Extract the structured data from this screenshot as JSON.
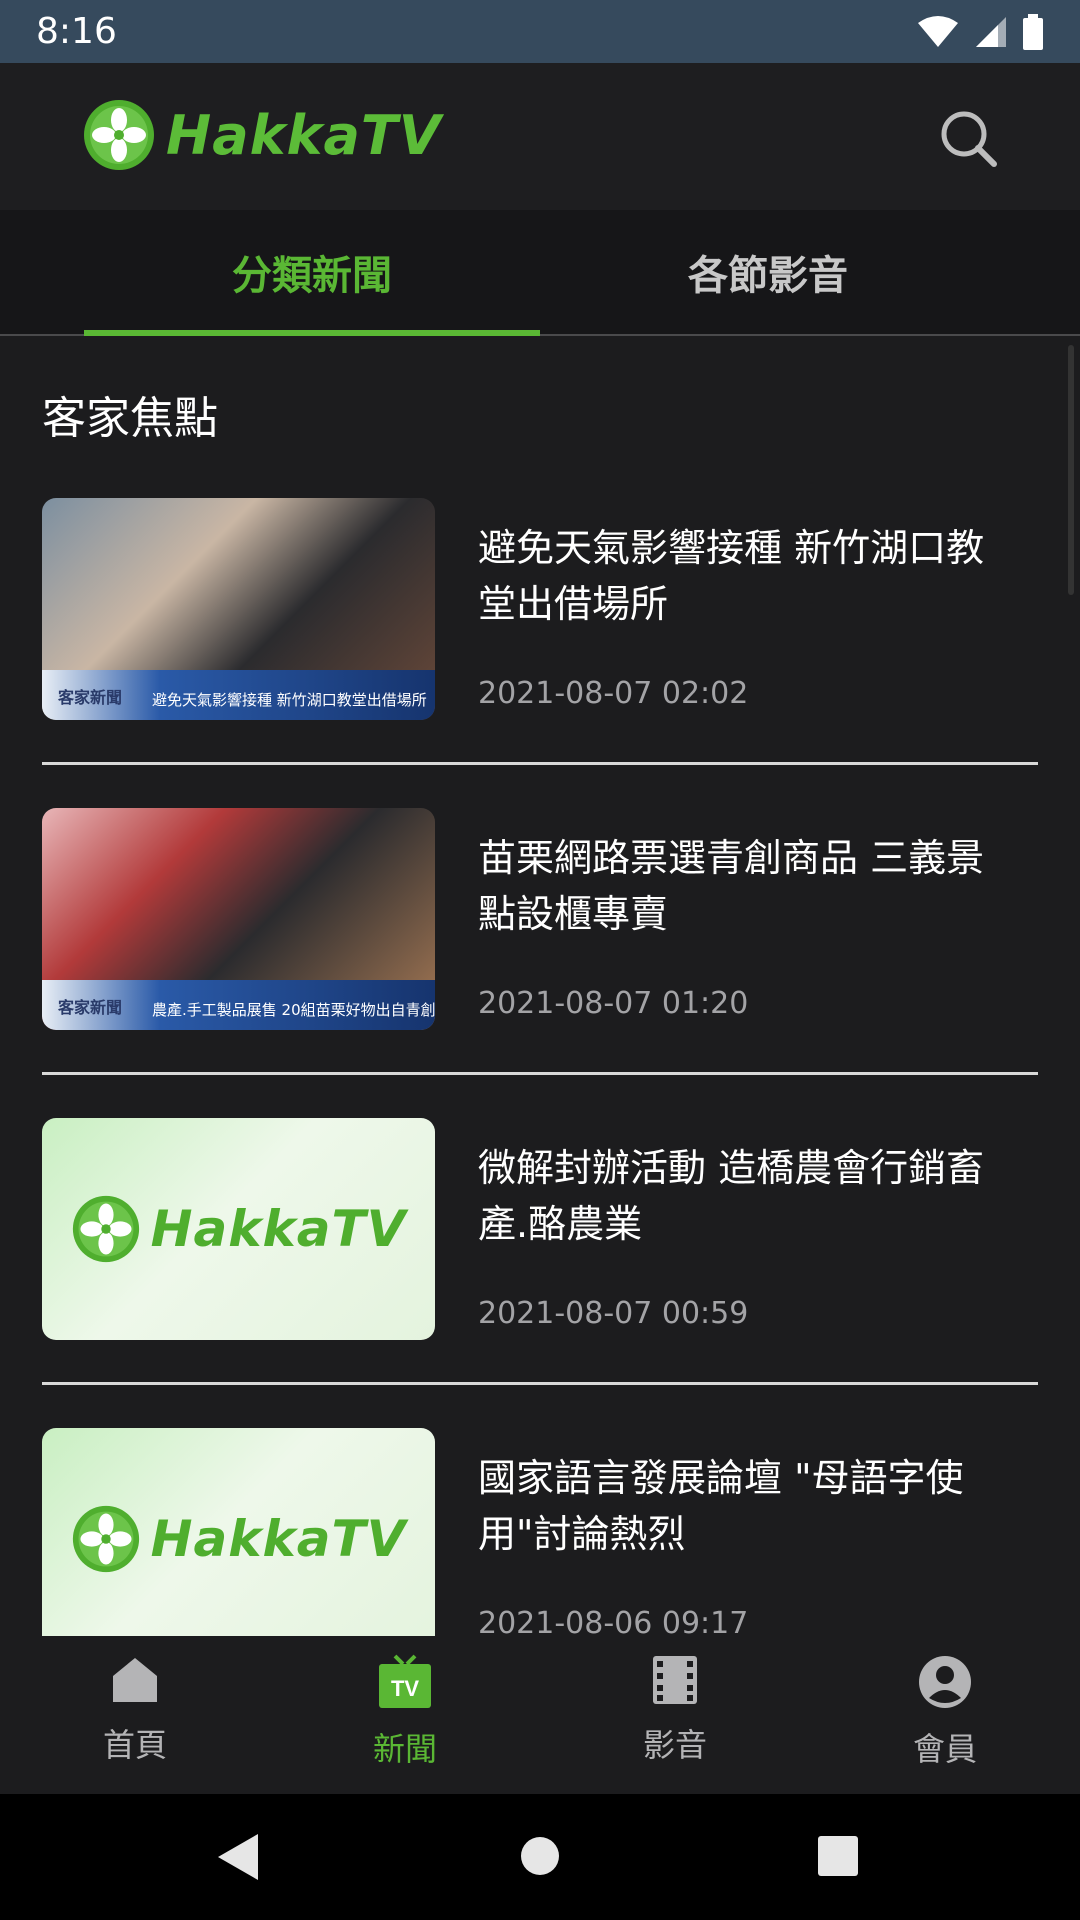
{
  "status_bar": {
    "time": "8:16"
  },
  "app_bar": {
    "logo_text": "HakkaTV"
  },
  "tabs": [
    {
      "label": "分類新聞",
      "active": true
    },
    {
      "label": "各節影音",
      "active": false
    }
  ],
  "section": {
    "title": "客家焦點"
  },
  "news": [
    {
      "title": "避免天氣影響接種 新竹湖口教堂出借場所",
      "date": "2021-08-07 02:02",
      "thumb_station": "客家新聞",
      "thumb_ticker": "避免天氣影響接種 新竹湖口教堂出借場所"
    },
    {
      "title": "苗栗網路票選青創商品 三義景點設櫃專賣",
      "date": "2021-08-07 01:20",
      "thumb_station": "客家新聞",
      "thumb_ticker": "農產.手工製品展售 20組苗栗好物出自青創"
    },
    {
      "title": "微解封辦活動 造橋農會行銷畜產.酪農業",
      "date": "2021-08-07 00:59",
      "thumb_logo": "HakkaTV"
    },
    {
      "title": "國家語言發展論壇 \"母語字使用\"討論熱烈",
      "date": "2021-08-06 09:17",
      "thumb_logo": "HakkaTV"
    }
  ],
  "bottom_nav": [
    {
      "label": "首頁",
      "icon": "home-icon",
      "active": false
    },
    {
      "label": "新聞",
      "icon": "tv-icon",
      "active": true
    },
    {
      "label": "影音",
      "icon": "film-icon",
      "active": false
    },
    {
      "label": "會員",
      "icon": "account-icon",
      "active": false
    }
  ],
  "colors": {
    "accent": "#5ab734",
    "background": "#1c1c1e",
    "status_bar": "#364a5d"
  }
}
